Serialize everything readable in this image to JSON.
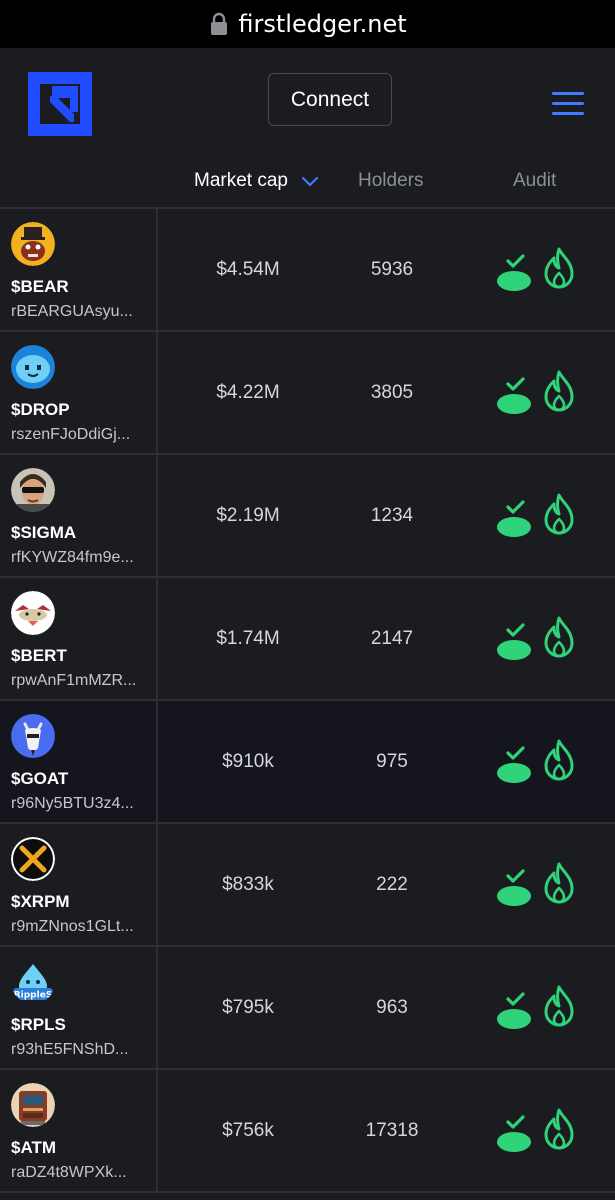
{
  "browser": {
    "url": "firstledger.net"
  },
  "header": {
    "connect_label": "Connect"
  },
  "columns": {
    "market_cap": "Market cap",
    "holders": "Holders",
    "audit": "Audit"
  },
  "colors": {
    "brand_blue": "#1f4dff",
    "accent_green": "#2fd37a",
    "menu_blue": "#3f7bff"
  },
  "tokens": [
    {
      "symbol": "$BEAR",
      "address": "rBEARGUAsyu...",
      "market_cap": "$4.54M",
      "holders": "5936",
      "avatar_icon": "bear-avatar-icon"
    },
    {
      "symbol": "$DROP",
      "address": "rszenFJoDdiGj...",
      "market_cap": "$4.22M",
      "holders": "3805",
      "avatar_icon": "drop-avatar-icon"
    },
    {
      "symbol": "$SIGMA",
      "address": "rfKYWZ84fm9e...",
      "market_cap": "$2.19M",
      "holders": "1234",
      "avatar_icon": "sigma-avatar-icon"
    },
    {
      "symbol": "$BERT",
      "address": "rpwAnF1mMZR...",
      "market_cap": "$1.74M",
      "holders": "2147",
      "avatar_icon": "bert-avatar-icon"
    },
    {
      "symbol": "$GOAT",
      "address": "r96Ny5BTU3z4...",
      "market_cap": "$910k",
      "holders": "975",
      "avatar_icon": "goat-avatar-icon"
    },
    {
      "symbol": "$XRPM",
      "address": "r9mZNnos1GLt...",
      "market_cap": "$833k",
      "holders": "222",
      "avatar_icon": "xrpm-avatar-icon"
    },
    {
      "symbol": "$RPLS",
      "address": "r93hE5FNShD...",
      "market_cap": "$795k",
      "holders": "963",
      "avatar_icon": "rpls-avatar-icon",
      "avatar_text": "RippleS"
    },
    {
      "symbol": "$ATM",
      "address": "raDZ4t8WPXk...",
      "market_cap": "$756k",
      "holders": "17318",
      "avatar_icon": "atm-avatar-icon"
    }
  ]
}
